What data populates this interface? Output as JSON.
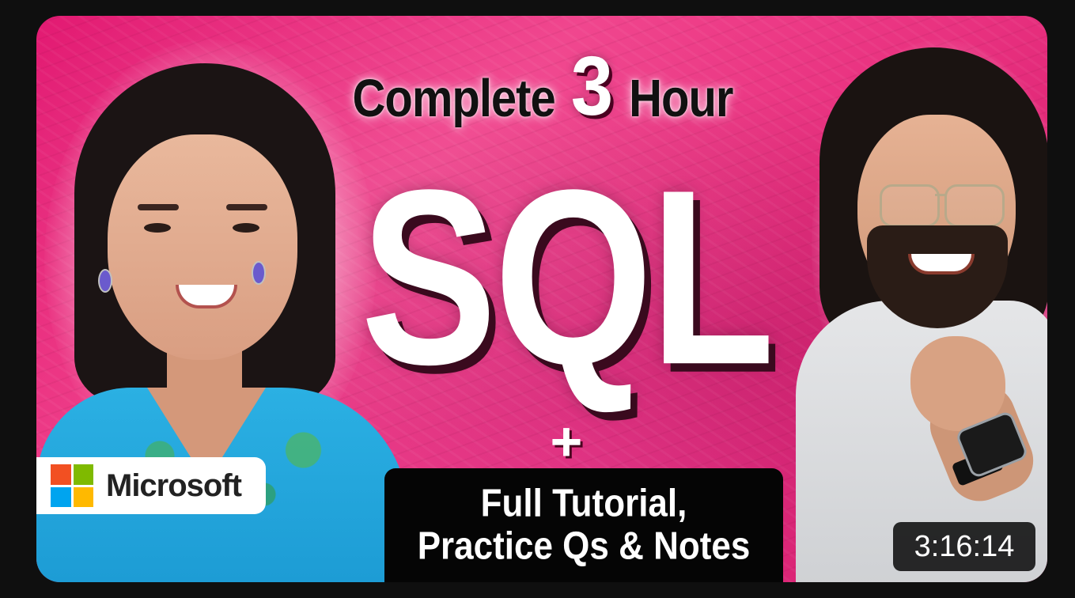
{
  "thumbnail": {
    "title_words": [
      "Complete",
      "3",
      "Hour"
    ],
    "main_text": "SQL",
    "plus_sign": "+",
    "subtitle_lines": [
      "Full Tutorial,",
      "Practice Qs & Notes"
    ],
    "badge": {
      "brand": "Microsoft",
      "logo_colors": [
        "#f25022",
        "#7fba00",
        "#00a4ef",
        "#ffb900"
      ]
    },
    "duration": "3:16:14",
    "colors": {
      "background": "#e8317f",
      "page_background": "#0f0f0f",
      "subtitle_box": "#050505"
    },
    "icons": [
      "microsoft-logo-icon"
    ]
  }
}
